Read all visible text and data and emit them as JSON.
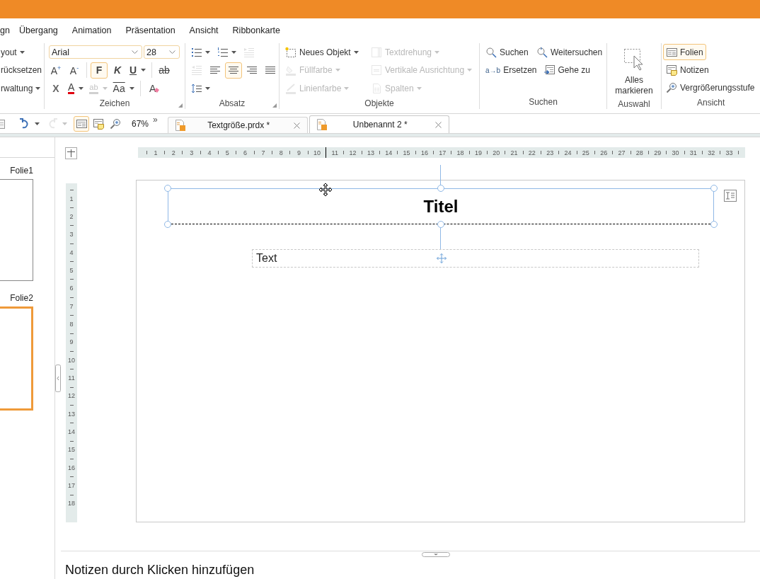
{
  "menu": [
    "gn",
    "Übergang",
    "Animation",
    "Präsentation",
    "Ansicht",
    "Ribbonkarte"
  ],
  "ribbon": [
    {
      "rows": [
        [
          {
            "kind": "text",
            "label": "yout",
            "caret": true,
            "disabled": false,
            "selected": false
          }
        ],
        [
          {
            "kind": "text",
            "label": "rücksetzen",
            "caret": false,
            "disabled": false,
            "selected": false
          }
        ],
        [
          {
            "kind": "text",
            "label": "rwaltung",
            "caret": true,
            "disabled": false,
            "selected": false
          }
        ]
      ]
    },
    {
      "label": "Zeichen",
      "launcher": true,
      "rows": [
        [
          {
            "kind": "field",
            "value": "Arial"
          },
          {
            "kind": "field",
            "value": "28"
          }
        ],
        [
          {
            "kind": "glyph",
            "label": "A$^{+}$",
            "caret": false,
            "disabled": false,
            "selected": false
          },
          {
            "kind": "glyph",
            "label": "A$^{-}$",
            "caret": false,
            "disabled": false,
            "selected": false
          },
          {
            "kind": "glyph",
            "label": "F",
            "caret": false,
            "disabled": false,
            "selected": true
          },
          {
            "kind": "glyph",
            "label": "K",
            "caret": false,
            "disabled": false,
            "selected": false
          },
          {
            "kind": "glyph",
            "label": "U",
            "caret": true,
            "disabled": false,
            "selected": false
          },
          {
            "kind": "glyph",
            "label": "ab",
            "caret": false,
            "disabled": false,
            "selected": false
          }
        ],
        [
          {
            "kind": "glyph",
            "label": "X",
            "caret": false,
            "disabled": false,
            "selected": false
          },
          {
            "kind": "glyph",
            "label": "A",
            "caret": true,
            "disabled": false,
            "selected": false
          },
          {
            "kind": "glyph",
            "label": "ab",
            "caret": true,
            "disabled": true,
            "selected": false
          },
          {
            "kind": "glyph",
            "label": "Aa",
            "caret": true,
            "disabled": false,
            "selected": false
          },
          {
            "kind": "glyph",
            "label": "A",
            "caret": false,
            "disabled": false,
            "selected": false
          }
        ]
      ]
    },
    {
      "label": "Absatz",
      "launcher": true,
      "rows": [
        [
          {
            "kind": "icon",
            "caret": true,
            "disabled": false,
            "selected": false
          },
          {
            "kind": "icon",
            "caret": true,
            "disabled": false,
            "selected": false
          },
          {
            "kind": "icon",
            "caret": false,
            "disabled": true,
            "selected": false
          }
        ],
        [
          {
            "kind": "icon",
            "caret": false,
            "disabled": true,
            "selected": false
          },
          {
            "kind": "icon",
            "caret": false,
            "disabled": false,
            "selected": false
          },
          {
            "kind": "icon",
            "caret": false,
            "disabled": false,
            "selected": true
          },
          {
            "kind": "icon",
            "caret": false,
            "disabled": false,
            "selected": false
          },
          {
            "kind": "icon",
            "caret": false,
            "disabled": false,
            "selected": false
          }
        ],
        [
          {
            "kind": "icon",
            "caret": true,
            "disabled": false,
            "selected": false
          }
        ]
      ]
    },
    {
      "label": "Objekte",
      "rows": [
        [
          {
            "kind": "text",
            "label": "Neues Objekt",
            "caret": true,
            "disabled": false,
            "selected": false
          },
          {
            "kind": "text",
            "label": "Textdrehung",
            "caret": true,
            "disabled": true,
            "selected": false
          }
        ],
        [
          {
            "kind": "text",
            "label": "Füllfarbe",
            "caret": true,
            "disabled": true,
            "selected": false
          },
          {
            "kind": "text",
            "label": "Vertikale Ausrichtung",
            "caret": true,
            "disabled": true,
            "selected": false
          }
        ],
        [
          {
            "kind": "text",
            "label": "Linienfarbe",
            "caret": true,
            "disabled": true,
            "selected": false
          },
          {
            "kind": "text",
            "label": "Spalten",
            "caret": true,
            "disabled": true,
            "selected": false
          }
        ]
      ]
    },
    {
      "label": "Suchen",
      "rows": [
        [
          {
            "kind": "text",
            "label": "Suchen",
            "caret": false,
            "disabled": false,
            "selected": false
          },
          {
            "kind": "text",
            "label": "Weitersuchen",
            "caret": false,
            "disabled": false,
            "selected": false
          }
        ],
        [
          {
            "kind": "text",
            "glyph": "a→b",
            "label": "Ersetzen",
            "caret": false,
            "disabled": false,
            "selected": false
          },
          {
            "kind": "text",
            "label": "Gehe zu",
            "caret": false,
            "disabled": false,
            "selected": false
          }
        ]
      ]
    },
    {
      "label": "Auswahl",
      "rows": [
        [
          {
            "kind": "large",
            "label": "Alles markieren",
            "caret": false,
            "disabled": false,
            "selected": false
          }
        ]
      ]
    },
    {
      "label": "Ansicht",
      "rows": [
        [
          {
            "kind": "text",
            "label": "Folien",
            "caret": false,
            "disabled": false,
            "selected": true
          }
        ],
        [
          {
            "kind": "text",
            "label": "Notizen",
            "caret": false,
            "disabled": false,
            "selected": false
          }
        ],
        [
          {
            "kind": "text",
            "label": "Vergrößerungsstufe",
            "caret": false,
            "disabled": false,
            "selected": false
          }
        ]
      ]
    }
  ],
  "quick_access": {
    "items": [
      {
        "caret": false,
        "disabled": false,
        "selected": false
      },
      {
        "caret": true,
        "disabled": false,
        "selected": false
      },
      {
        "caret": true,
        "disabled": true,
        "selected": false
      },
      {
        "caret": false,
        "disabled": false,
        "selected": true
      },
      {
        "caret": false,
        "disabled": false,
        "selected": false
      },
      {
        "caret": false,
        "disabled": false,
        "selected": false
      }
    ],
    "zoom": "67%",
    "overflow": "»"
  },
  "doc_tabs": [
    {
      "label": "Textgröße.prdx *",
      "selected": false
    },
    {
      "label": "Unbenannt 2 *",
      "selected": true
    }
  ],
  "slides": [
    {
      "label": "Folie1",
      "selected": false
    },
    {
      "label": "Folie2",
      "selected": true
    }
  ],
  "rulers": {
    "horizontal": [
      "1",
      "2",
      "3",
      "4",
      "5",
      "6",
      "7",
      "8",
      "9",
      "10",
      "11",
      "12",
      "13",
      "14",
      "15",
      "16",
      "17",
      "18",
      "19",
      "20",
      "21",
      "22",
      "23",
      "24",
      "25",
      "26",
      "27",
      "28",
      "29",
      "30",
      "31",
      "32",
      "33"
    ],
    "vertical": [
      "1",
      "2",
      "3",
      "4",
      "5",
      "6",
      "7",
      "8",
      "9",
      "10",
      "11",
      "12",
      "13",
      "14",
      "15",
      "16",
      "17",
      "18"
    ]
  },
  "slide": {
    "title": {
      "text": "Titel",
      "selected": true
    },
    "body": {
      "text": "Text"
    }
  },
  "notes": {
    "placeholder": "Notizen durch Klicken hinzufügen"
  }
}
